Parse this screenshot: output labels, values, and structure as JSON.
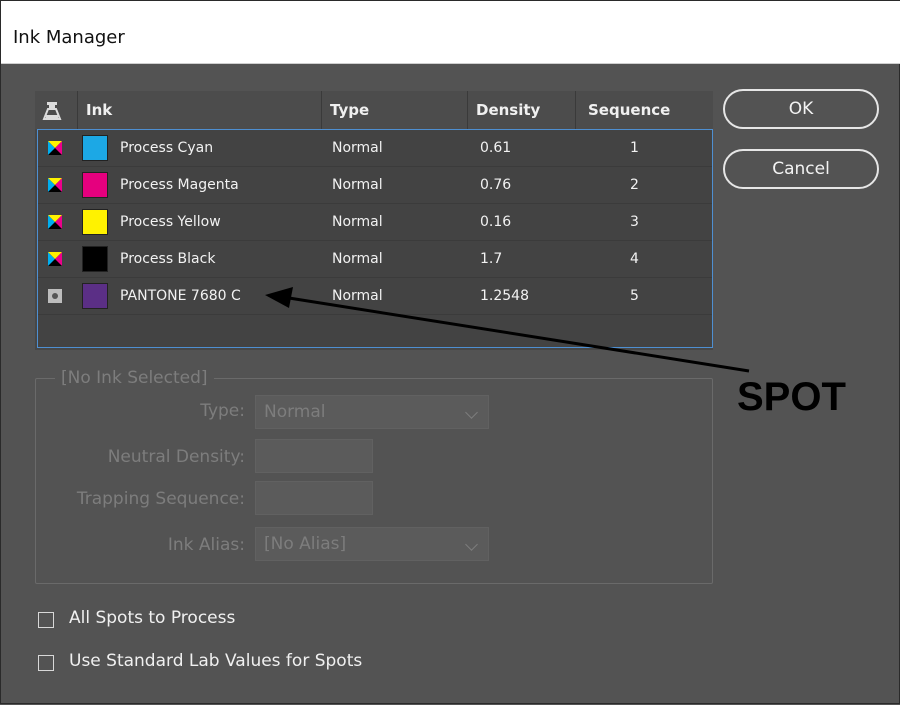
{
  "window": {
    "title": "Ink Manager"
  },
  "table": {
    "headers": {
      "ink": "Ink",
      "type": "Type",
      "density": "Density",
      "sequence": "Sequence"
    },
    "rows": [
      {
        "icon": "process-cmyk-icon",
        "swatch": "#1ca8e5",
        "name": "Process Cyan",
        "type": "Normal",
        "density": "0.61",
        "sequence": "1"
      },
      {
        "icon": "process-cmyk-icon",
        "swatch": "#e5007e",
        "name": "Process Magenta",
        "type": "Normal",
        "density": "0.76",
        "sequence": "2"
      },
      {
        "icon": "process-cmyk-icon",
        "swatch": "#fff200",
        "name": "Process Yellow",
        "type": "Normal",
        "density": "0.16",
        "sequence": "3"
      },
      {
        "icon": "process-cmyk-icon",
        "swatch": "#000000",
        "name": "Process Black",
        "type": "Normal",
        "density": "1.7",
        "sequence": "4"
      },
      {
        "icon": "spot-ink-icon",
        "swatch": "#5b2f86",
        "name": "PANTONE 7680 C",
        "type": "Normal",
        "density": "1.2548",
        "sequence": "5"
      }
    ]
  },
  "buttons": {
    "ok": "OK",
    "cancel": "Cancel"
  },
  "ink_settings": {
    "legend": "[No Ink Selected]",
    "type_label": "Type:",
    "type_value": "Normal",
    "neutral_density_label": "Neutral Density:",
    "neutral_density_value": "",
    "trapping_sequence_label": "Trapping Sequence:",
    "trapping_sequence_value": "",
    "ink_alias_label": "Ink Alias:",
    "ink_alias_value": "[No Alias]"
  },
  "options": {
    "all_spots_to_process": "All Spots to Process",
    "use_standard_lab": "Use Standard Lab Values for Spots"
  },
  "annotation": {
    "text": "SPOT"
  },
  "colors": {
    "selection_border": "#4e8fd1",
    "dialog_bg": "#535353"
  }
}
